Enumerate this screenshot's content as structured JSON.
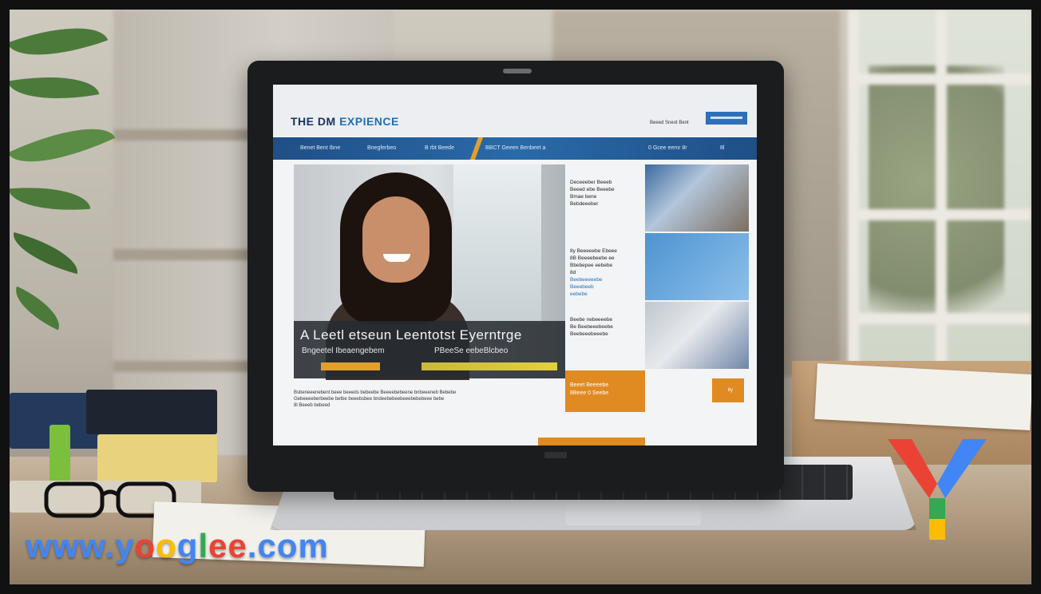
{
  "website": {
    "title_part1": "THE DM ",
    "title_part2": "EXPIENCE",
    "top_link": "Beeed Sneot Bent",
    "nav": {
      "item1": "Benet Bent Ibne",
      "item2": "Bnegferbeo",
      "item3": "B rbt Beede",
      "item4": "BBCT Geeen Benbeet a",
      "item5": "0 Gcee eemr 8r",
      "item6": "8l"
    },
    "hero": {
      "headline": "A Leetl etseun Leentotst Eyerntrge",
      "subtitle_left": "Bngeetel Ibeaengebem",
      "subtitle_right": "PBeeSe eebeBlcbeo"
    },
    "intro_line1": "Bsbeneeenebent beee beeeds bebeebe Beeeebebeene bnbeeeneb Bebebe",
    "intro_line2": "Gebeeeeberbeebe betbe beeebsbee bndeebebeebeeebebebeee bebe",
    "intro_line3": "8l Beeeb bebeed",
    "side_cards": [
      {
        "line1": "Deceeeber Beeeb",
        "line2": "Beeed ebe Beeebe",
        "line3": "Bmae bene",
        "line4": "Bebdeeeber"
      },
      {
        "line1": "8y Beeeeebe Ebeee",
        "line2": "8B Beeeebeebe ee",
        "line3": "Bbebepee eebebe",
        "line4": "8d",
        "link1": "Beebeeeeebe",
        "link2": "Beeebeeb",
        "link3": "eebebe"
      },
      {
        "line1": "Beebe nebeeeebe",
        "line2": "Be Beebeeebeebe",
        "line3": "Beebeeebeeebe"
      }
    ],
    "orange_card": {
      "line1": "Beeet Beeeebe",
      "line2": "8Beee 0 Seebe"
    },
    "orange_badge": "8y"
  },
  "watermark": {
    "url": "www.yooglee.com",
    "url_parts": [
      "www.",
      "y",
      "o",
      "o",
      "g",
      "l",
      "e",
      "e",
      ".com"
    ],
    "colors": [
      "#4285F4",
      "#EA4335",
      "#FBBC05",
      "#34A853",
      "#4285F4"
    ]
  }
}
